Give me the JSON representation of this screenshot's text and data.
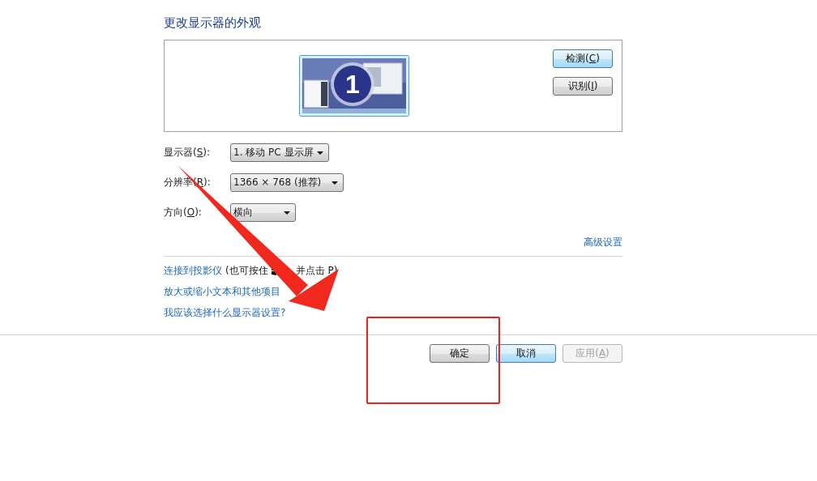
{
  "title": "更改显示器的外观",
  "preview": {
    "display_number": "1",
    "buttons": [
      {
        "label": "检测(",
        "access_key": "C",
        "label_after": ")",
        "focused": true
      },
      {
        "label": "识别(",
        "access_key": "I",
        "label_after": ")",
        "focused": false
      }
    ]
  },
  "settings": [
    {
      "label": "显示器(",
      "access_key": "S",
      "label_after": "):",
      "value": "1. 移动 PC 显示屏",
      "kind": "medium"
    },
    {
      "label": "分辨率(",
      "access_key": "R",
      "label_after": "):",
      "value": "1366 × 768 (推荐)",
      "kind": "wide"
    },
    {
      "label": "方向(",
      "access_key": "O",
      "label_after": "):",
      "value": "横向",
      "kind": "narrow"
    }
  ],
  "advanced_link": "高级设置",
  "links": [
    {
      "text": "连接到投影仪",
      "note_before": "(也可按住",
      "note_after": "并点击 P)"
    },
    {
      "text": "放大或缩小文本和其他项目"
    },
    {
      "text": "我应该选择什么显示器设置?"
    }
  ],
  "footer_buttons": [
    {
      "label": "确定",
      "disabled": false,
      "focused": false
    },
    {
      "label": "取消",
      "disabled": false,
      "focused": true
    },
    {
      "label": "应用(",
      "access_key": "A",
      "label_after": ")",
      "disabled": true,
      "focused": false
    }
  ]
}
